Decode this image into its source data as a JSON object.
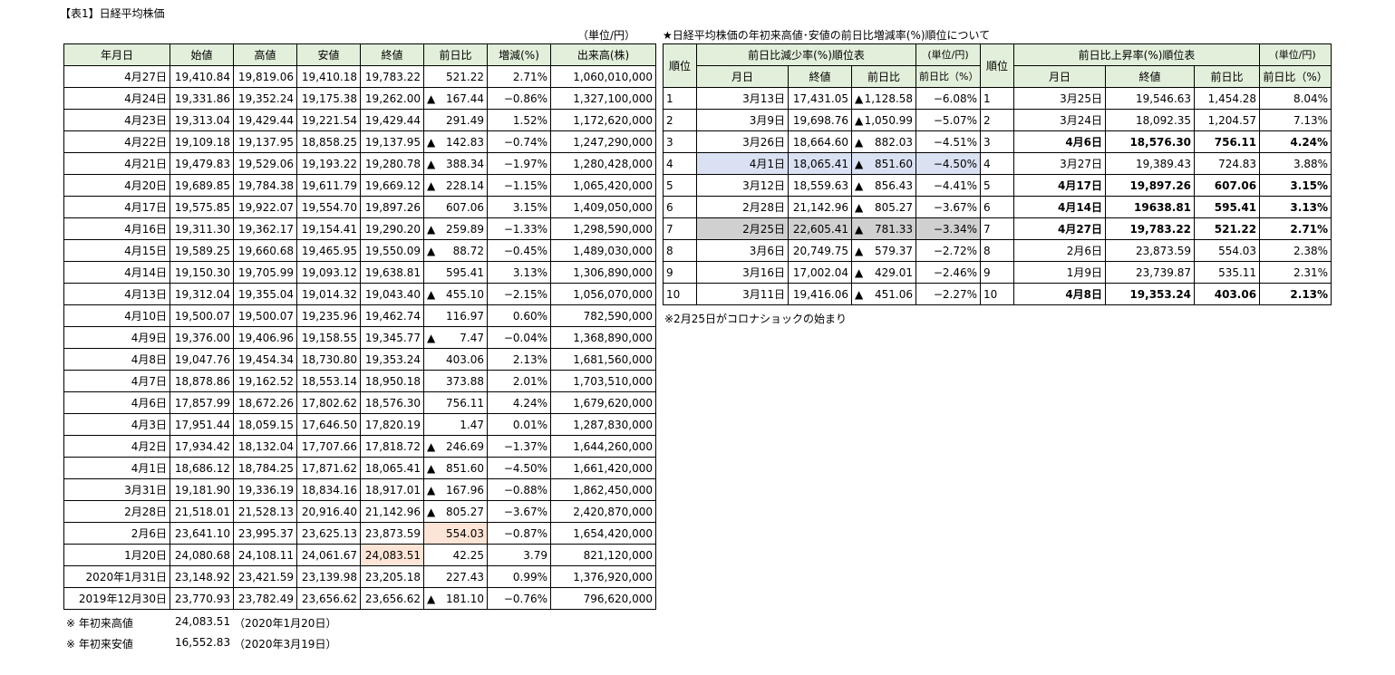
{
  "main": {
    "title": "【表1】日経平均株価",
    "unit": "（単位/円）",
    "headers": [
      "年月日",
      "始値",
      "高値",
      "安値",
      "終値",
      "前日比",
      "増減(%)",
      "出来高(株)"
    ],
    "rows": [
      [
        "4月27日",
        "19,410.84",
        "19,819.06",
        "19,410.18",
        "19,783.22",
        "",
        "521.22",
        "2.71%",
        "1,060,010,000"
      ],
      [
        "4月24日",
        "19,331.86",
        "19,352.24",
        "19,175.38",
        "19,262.00",
        "▲",
        "167.44",
        "−0.86%",
        "1,327,100,000"
      ],
      [
        "4月23日",
        "19,313.04",
        "19,429.44",
        "19,221.54",
        "19,429.44",
        "",
        "291.49",
        "1.52%",
        "1,172,620,000"
      ],
      [
        "4月22日",
        "19,109.18",
        "19,137.95",
        "18,858.25",
        "19,137.95",
        "▲",
        "142.83",
        "−0.74%",
        "1,247,290,000"
      ],
      [
        "4月21日",
        "19,479.83",
        "19,529.06",
        "19,193.22",
        "19,280.78",
        "▲",
        "388.34",
        "−1.97%",
        "1,280,428,000"
      ],
      [
        "4月20日",
        "19,689.85",
        "19,784.38",
        "19,611.79",
        "19,669.12",
        "▲",
        "228.14",
        "−1.15%",
        "1,065,420,000"
      ],
      [
        "4月17日",
        "19,575.85",
        "19,922.07",
        "19,554.70",
        "19,897.26",
        "",
        "607.06",
        "3.15%",
        "1,409,050,000"
      ],
      [
        "4月16日",
        "19,311.30",
        "19,362.17",
        "19,154.41",
        "19,290.20",
        "▲",
        "259.89",
        "−1.33%",
        "1,298,590,000"
      ],
      [
        "4月15日",
        "19,589.25",
        "19,660.68",
        "19,465.95",
        "19,550.09",
        "▲",
        "88.72",
        "−0.45%",
        "1,489,030,000"
      ],
      [
        "4月14日",
        "19,150.30",
        "19,705.99",
        "19,093.12",
        "19,638.81",
        "",
        "595.41",
        "3.13%",
        "1,306,890,000"
      ],
      [
        "4月13日",
        "19,312.04",
        "19,355.04",
        "19,014.32",
        "19,043.40",
        "▲",
        "455.10",
        "−2.15%",
        "1,056,070,000"
      ],
      [
        "4月10日",
        "19,500.07",
        "19,500.07",
        "19,235.96",
        "19,462.74",
        "",
        "116.97",
        "0.60%",
        "782,590,000"
      ],
      [
        "4月9日",
        "19,376.00",
        "19,406.96",
        "19,158.55",
        "19,345.77",
        "▲",
        "7.47",
        "−0.04%",
        "1,368,890,000"
      ],
      [
        "4月8日",
        "19,047.76",
        "19,454.34",
        "18,730.80",
        "19,353.24",
        "",
        "403.06",
        "2.13%",
        "1,681,560,000"
      ],
      [
        "4月7日",
        "18,878.86",
        "19,162.52",
        "18,553.14",
        "18,950.18",
        "",
        "373.88",
        "2.01%",
        "1,703,510,000"
      ],
      [
        "4月6日",
        "17,857.99",
        "18,672.26",
        "17,802.62",
        "18,576.30",
        "",
        "756.11",
        "4.24%",
        "1,679,620,000"
      ],
      [
        "4月3日",
        "17,951.44",
        "18,059.15",
        "17,646.50",
        "17,820.19",
        "",
        "1.47",
        "0.01%",
        "1,287,830,000"
      ],
      [
        "4月2日",
        "17,934.42",
        "18,132.04",
        "17,707.66",
        "17,818.72",
        "▲",
        "246.69",
        "−1.37%",
        "1,644,260,000"
      ],
      [
        "4月1日",
        "18,686.12",
        "18,784.25",
        "17,871.62",
        "18,065.41",
        "▲",
        "851.60",
        "−4.50%",
        "1,661,420,000"
      ],
      [
        "3月31日",
        "19,181.90",
        "19,336.19",
        "18,834.16",
        "18,917.01",
        "▲",
        "167.96",
        "−0.88%",
        "1,862,450,000"
      ],
      [
        "2月28日",
        "21,518.01",
        "21,528.13",
        "20,916.40",
        "21,142.96",
        "▲",
        "805.27",
        "−3.67%",
        "2,420,870,000"
      ],
      [
        "2月6日",
        "23,641.10",
        "23,995.37",
        "23,625.13",
        "23,873.59",
        "",
        "554.03",
        "−0.87%",
        "1,654,420,000"
      ],
      [
        "1月20日",
        "24,080.68",
        "24,108.11",
        "24,061.67",
        "24,083.51",
        "",
        "42.25",
        "3.79",
        "821,120,000"
      ],
      [
        "2020年1月31日",
        "23,148.92",
        "23,421.59",
        "23,139.98",
        "23,205.18",
        "",
        "227.43",
        "0.99%",
        "1,376,920,000"
      ],
      [
        "2019年12月30日",
        "23,770.93",
        "23,782.49",
        "23,656.62",
        "23,656.62",
        "▲",
        "181.10",
        "−0.76%",
        "796,620,000"
      ]
    ],
    "notes": [
      {
        "label": "※ 年初来高値",
        "value": "24,083.51",
        "date": "（2020年1月20日）"
      },
      {
        "label": "※ 年初来安値",
        "value": "16,552.83",
        "date": "（2020年3月19日）"
      }
    ]
  },
  "ranking": {
    "title": "★日経平均株価の年初来高値･安値の前日比増減率(%)順位について",
    "rank_label": "順位",
    "decrease_title": "前日比減少率(%)順位表",
    "decrease_unit": "(単位/円)",
    "increase_title": "前日比上昇率(%)順位表",
    "increase_unit": "(単位/円)",
    "sub_headers": [
      "月日",
      "終値",
      "前日比",
      "前日比（%）"
    ],
    "decrease_rows": [
      [
        "1",
        "3月13日",
        "17,431.05",
        "▲",
        "1,128.58",
        "−6.08%"
      ],
      [
        "2",
        "3月9日",
        "19,698.76",
        "▲",
        "1,050.99",
        "−5.07%"
      ],
      [
        "3",
        "3月26日",
        "18,664.60",
        "▲",
        "882.03",
        "−4.51%"
      ],
      [
        "4",
        "4月1日",
        "18,065.41",
        "▲",
        "851.60",
        "−4.50%"
      ],
      [
        "5",
        "3月12日",
        "18,559.63",
        "▲",
        "856.43",
        "−4.41%"
      ],
      [
        "6",
        "2月28日",
        "21,142.96",
        "▲",
        "805.27",
        "−3.67%"
      ],
      [
        "7",
        "2月25日",
        "22,605.41",
        "▲",
        "781.33",
        "−3.34%"
      ],
      [
        "8",
        "3月6日",
        "20,749.75",
        "▲",
        "579.37",
        "−2.72%"
      ],
      [
        "9",
        "3月16日",
        "17,002.04",
        "▲",
        "429.01",
        "−2.46%"
      ],
      [
        "10",
        "3月11日",
        "19,416.06",
        "▲",
        "451.06",
        "−2.27%"
      ]
    ],
    "increase_rows": [
      [
        "1",
        "3月25日",
        "19,546.63",
        "1,454.28",
        "8.04%"
      ],
      [
        "2",
        "3月24日",
        "18,092.35",
        "1,204.57",
        "7.13%"
      ],
      [
        "3",
        "4月6日",
        "18,576.30",
        "756.11",
        "4.24%"
      ],
      [
        "4",
        "3月27日",
        "19,389.43",
        "724.83",
        "3.88%"
      ],
      [
        "5",
        "4月17日",
        "19,897.26",
        "607.06",
        "3.15%"
      ],
      [
        "6",
        "4月14日",
        "19638.81",
        "595.41",
        "3.13%"
      ],
      [
        "7",
        "4月27日",
        "19,783.22",
        "521.22",
        "2.71%"
      ],
      [
        "8",
        "2月6日",
        "23,873.59",
        "554.03",
        "2.38%"
      ],
      [
        "9",
        "1月9日",
        "23,739.87",
        "535.11",
        "2.31%"
      ],
      [
        "10",
        "4月8日",
        "19,353.24",
        "403.06",
        "2.13%"
      ]
    ],
    "note": "※2月25日がコロナショックの始まり"
  }
}
